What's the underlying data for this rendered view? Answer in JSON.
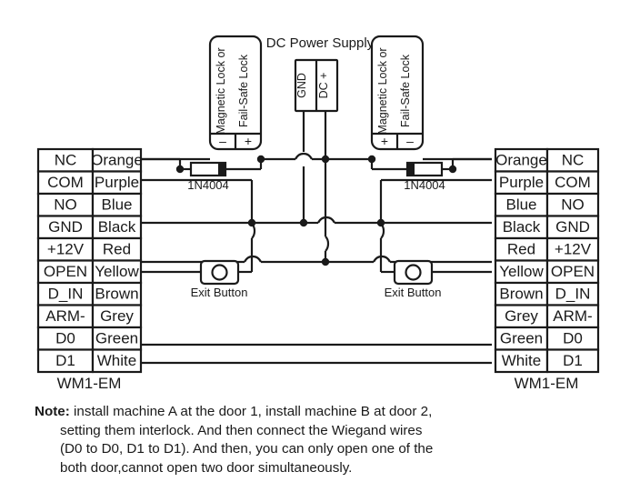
{
  "diagram": {
    "title": "Two-door interlock wiring diagram",
    "power_supply": {
      "label": "DC Power Supply",
      "terminals": [
        "GND",
        "DC +"
      ]
    },
    "locks": [
      {
        "id": "lock-left",
        "line1": "Magnetic Lock or",
        "line2": "Fail-Safe Lock",
        "terminals": [
          "–",
          "+"
        ],
        "diode": "1N4004"
      },
      {
        "id": "lock-right",
        "line1": "Magnetic Lock or",
        "line2": "Fail-Safe Lock",
        "terminals": [
          "+",
          "–"
        ],
        "diode": "1N4004"
      }
    ],
    "exit_buttons": [
      {
        "id": "exit-button-left",
        "label": "Exit Button"
      },
      {
        "id": "exit-button-right",
        "label": "Exit Button"
      }
    ],
    "devices": [
      {
        "id": "device-left",
        "label": "WM1-EM"
      },
      {
        "id": "device-right",
        "label": "WM1-EM"
      }
    ],
    "terminal_tables": {
      "columns_left": [
        "function",
        "wire_color"
      ],
      "columns_right": [
        "wire_color",
        "function"
      ],
      "rows": [
        {
          "function": "NC",
          "wire_color": "Orange",
          "wired": true
        },
        {
          "function": "COM",
          "wire_color": "Purple",
          "wired": true
        },
        {
          "function": "NO",
          "wire_color": "Blue",
          "wired": false
        },
        {
          "function": "GND",
          "wire_color": "Black",
          "wired": true
        },
        {
          "function": "+12V",
          "wire_color": "Red",
          "wired": true
        },
        {
          "function": "OPEN",
          "wire_color": "Yellow",
          "wired": true
        },
        {
          "function": "D_IN",
          "wire_color": "Brown",
          "wired": false
        },
        {
          "function": "ARM-",
          "wire_color": "Grey",
          "wired": false
        },
        {
          "function": "D0",
          "wire_color": "Green",
          "wired": true
        },
        {
          "function": "D1",
          "wire_color": "White",
          "wired": true
        }
      ]
    }
  },
  "note": {
    "keyword": "Note:",
    "lines": [
      " install machine A at the door 1, install machine B at door 2,",
      "setting them interlock. And then connect the Wiegand wires",
      "(D0 to D0, D1 to D1). And then, you can only open one of the",
      "both door,cannot open two door simultaneously."
    ]
  },
  "colors": {
    "ink": "#1a1a1a",
    "background": "#ffffff"
  }
}
